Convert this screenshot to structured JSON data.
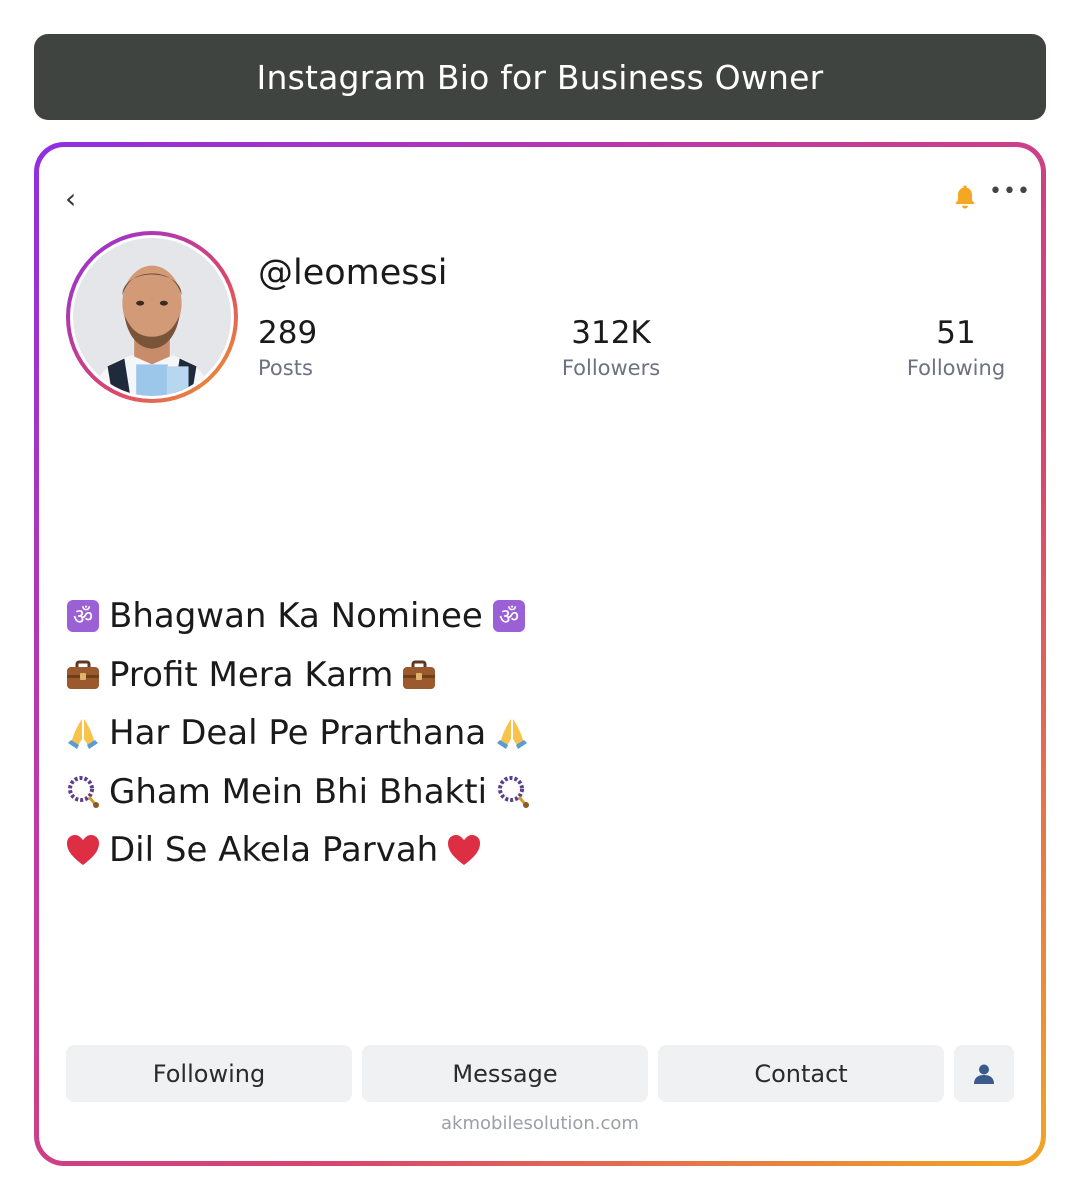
{
  "header": {
    "title": "Instagram Bio for Business Owner"
  },
  "profile": {
    "username": "@leomessi",
    "stats": [
      {
        "value": "289",
        "label": "Posts"
      },
      {
        "value": "312K",
        "label": "Followers"
      },
      {
        "value": "51",
        "label": "Following"
      }
    ]
  },
  "icons": {
    "back": "chevron-left-icon",
    "bell": "bell-icon",
    "more": "more-horizontal-icon",
    "add_user": "person-icon"
  },
  "bio": [
    {
      "text": "Bhagwan Ka Nominee",
      "emoji": "om-icon"
    },
    {
      "text": "Profit Mera Karm",
      "emoji": "briefcase-icon"
    },
    {
      "text": "Har Deal Pe Prarthana",
      "emoji": "folded-hands-icon"
    },
    {
      "text": "Gham Mein Bhi Bhakti",
      "emoji": "prayer-beads-icon"
    },
    {
      "text": "Dil Se Akela Parvah",
      "emoji": "red-heart-icon"
    }
  ],
  "buttons": {
    "following": "Following",
    "message": "Message",
    "contact": "Contact"
  },
  "footer": "akmobilesolution.com",
  "colors": {
    "title_bg": "#3f4440",
    "gradient_start": "#8f2fe0",
    "gradient_mid": "#d9456e",
    "gradient_end": "#f2a623",
    "bell": "#f5a623",
    "button_bg": "#f0f1f3",
    "muted_text": "#6b7280"
  }
}
